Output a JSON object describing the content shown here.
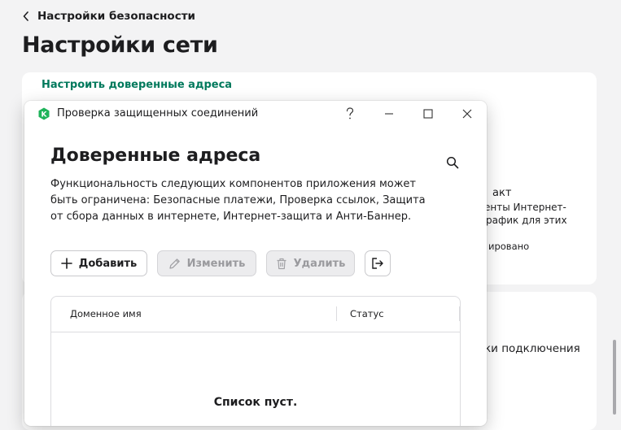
{
  "header": {
    "back_label": "Настройки безопасности",
    "page_title": "Настройки сети"
  },
  "background": {
    "link": "Настроить доверенные адреса",
    "fragments": [
      "акт",
      "енты Интернет-",
      "рафик для этих",
      "ировано",
      "ки подключения"
    ]
  },
  "dialog": {
    "window_title": "Проверка защищенных соединений",
    "app_icon_letter": "K",
    "app_icon_color": "#1eb35a",
    "title": "Доверенные адреса",
    "description": "Функциональность следующих компонентов приложения может быть ограничена: Безопасные платежи, Проверка ссылок, Защита от сбора данных в интернете, Интернет-защита и Анти-Баннер.",
    "toolbar": {
      "add_label": "Добавить",
      "edit_label": "Изменить",
      "delete_label": "Удалить"
    },
    "table": {
      "columns": [
        "Доменное имя",
        "Статус"
      ],
      "rows": [],
      "empty_text": "Список пуст."
    }
  },
  "colors": {
    "link": "#00795c",
    "accent_icon": "#1eb35a"
  }
}
